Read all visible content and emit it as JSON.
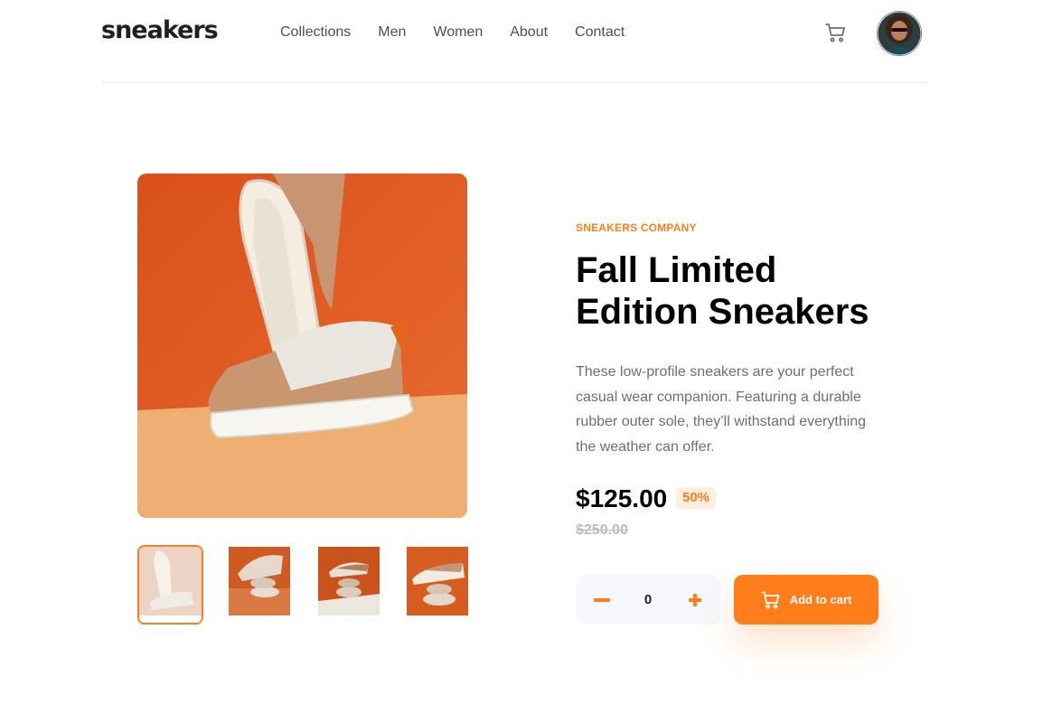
{
  "header": {
    "logo": "sneakers",
    "nav": [
      "Collections",
      "Men",
      "Women",
      "About",
      "Contact"
    ],
    "cart_icon": "cart-icon",
    "avatar_icon": "user-avatar"
  },
  "product": {
    "company": "SNEAKERS COMPANY",
    "title": "Fall Limited Edition Sneakers",
    "description": "These low-profile sneakers are your perfect casual wear companion. Featuring a durable rubber outer sole, they’ll withstand everything the weather can offer.",
    "price": "$125.00",
    "discount": "50%",
    "old_price": "$250.00"
  },
  "cart": {
    "quantity": "0",
    "add_label": "Add to cart"
  },
  "gallery": {
    "selected_index": 0,
    "thumbnail_count": 4
  },
  "colors": {
    "accent": "#ff7d1a",
    "accent_pale": "#ffede0",
    "text_dark": "#1d2026",
    "text_grey": "#68707d",
    "qty_bg": "#f6f8fd"
  }
}
